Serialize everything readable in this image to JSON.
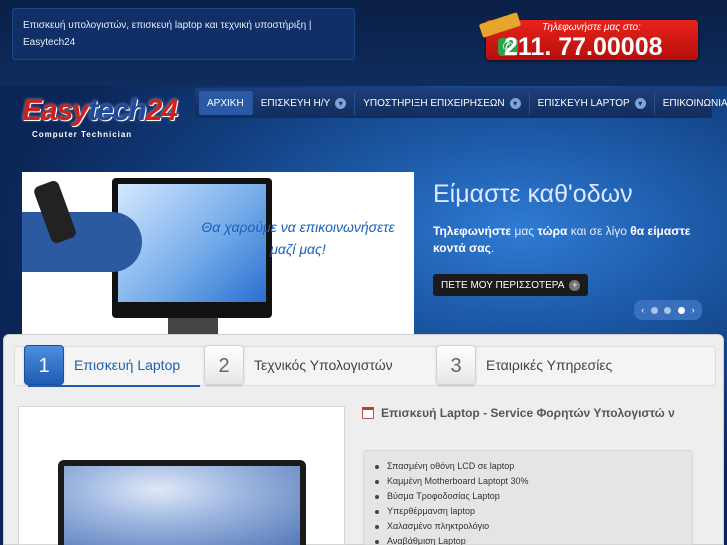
{
  "header": {
    "site_title": "Επισκευή υπολογιστών, επισκευή laptop και τεχνική υποστήριξη | Easytech24",
    "phone_label": "Τηλεφωνήστε μας στο:",
    "phone_number": "211. 77.00008"
  },
  "logo": {
    "word_a": "Easy",
    "word_b": "tech",
    "word_c": "24",
    "sub": "Computer Technician"
  },
  "nav": {
    "items": [
      {
        "label": "ΑΡΧΙΚΗ",
        "dropdown": false,
        "active": true
      },
      {
        "label": "ΕΠΙΣΚΕΥΗ Η/Υ",
        "dropdown": true
      },
      {
        "label": "ΥΠΟΣΤΗΡΙΞΗ ΕΠΙΧΕΙΡΗΣΕΩΝ",
        "dropdown": true
      },
      {
        "label": "ΕΠΙΣΚΕΥΗ LAPTOP",
        "dropdown": true
      },
      {
        "label": "ΕΠΙΚΟΙΝΩΝΙΑ",
        "dropdown": false
      }
    ]
  },
  "slider": {
    "image_caption": "Θα χαρούμε να επικοινωνήσετε μαζί μας!",
    "title": "Είμαστε καθ'οδων",
    "text_1": "Τηλεφωνήστε",
    "text_2": " μας ",
    "text_3": "τώρα",
    "text_4": " και σε λίγο ",
    "text_5": "θα είμαστε κοντά σας",
    "text_6": ".",
    "button_label": "ΠΕΤΕ ΜΟΥ ΠΕΡΙΣΣΟΤΕΡΑ",
    "prev": "‹",
    "next": "›",
    "active_slide": 3,
    "slide_count": 3
  },
  "tabs": [
    {
      "num": "1",
      "label": "Επισκευή Laptop",
      "active": true
    },
    {
      "num": "2",
      "label": "Τεχνικός Υπολογιστών",
      "active": false
    },
    {
      "num": "3",
      "label": "Εταιρικές Υπηρεσίες",
      "active": false
    }
  ],
  "post": {
    "title": "Επισκευή Laptop - Service Φορητών Υπολογιστώ ν",
    "items": [
      "Σπασμένη οθόνη LCD σε laptop",
      "Καμμένη Motherboard Laptopt 30%",
      "Βύσμα Τροφοδοσίας Laptop",
      "Υπερθέρμανση laptop",
      "Χαλασμένο πληκτρολόγιο",
      "Αναβάθμιση Laptop"
    ]
  },
  "colors": {
    "accent": "#1f5cb3",
    "phone_red": "#d81c16",
    "logo_red": "#d0201b"
  }
}
